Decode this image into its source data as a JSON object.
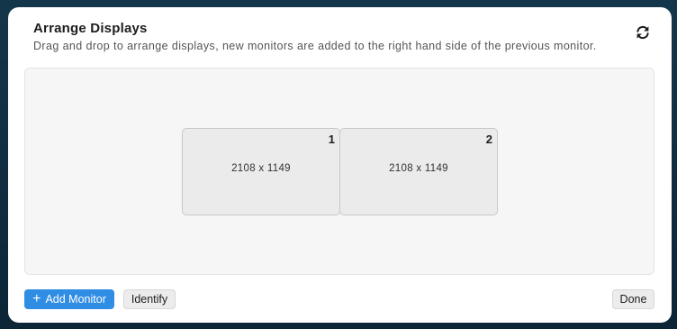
{
  "dialog": {
    "title": "Arrange Displays",
    "subtitle": "Drag and drop to arrange displays, new monitors are added to the right hand side of the previous monitor.",
    "refresh_icon": "refresh-icon"
  },
  "monitors": [
    {
      "number": "1",
      "resolution": "2108 x 1149"
    },
    {
      "number": "2",
      "resolution": "2108 x 1149"
    }
  ],
  "footer": {
    "add_monitor_label": "Add Monitor",
    "add_icon": "plus-icon",
    "identify_label": "Identify",
    "done_label": "Done"
  },
  "colors": {
    "accent": "#2f8de4",
    "background": "#0f2b3d"
  }
}
